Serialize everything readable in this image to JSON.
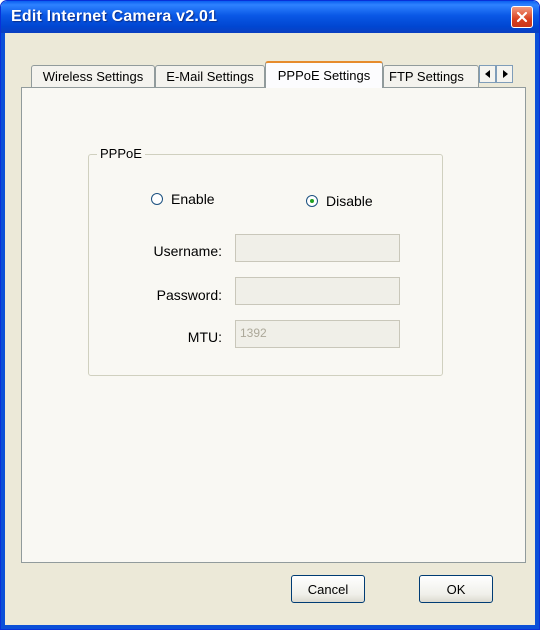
{
  "window": {
    "title": "Edit Internet Camera v2.01"
  },
  "tabs": [
    {
      "label": "Wireless Settings"
    },
    {
      "label": "E-Mail Settings"
    },
    {
      "label": "PPPoE Settings",
      "active": true
    },
    {
      "label": "FTP Settings"
    }
  ],
  "group": {
    "title": "PPPoE",
    "radio_enable": {
      "label": "Enable",
      "checked": false
    },
    "radio_disable": {
      "label": "Disable",
      "checked": true
    },
    "username": {
      "label": "Username:",
      "value": ""
    },
    "password": {
      "label": "Password:",
      "value": ""
    },
    "mtu": {
      "label": "MTU:",
      "value": "1392"
    }
  },
  "buttons": {
    "cancel": "Cancel",
    "ok": "OK"
  },
  "icons": {
    "close": "close-icon",
    "scroll_left": "arrow-left-icon",
    "scroll_right": "arrow-right-icon"
  }
}
